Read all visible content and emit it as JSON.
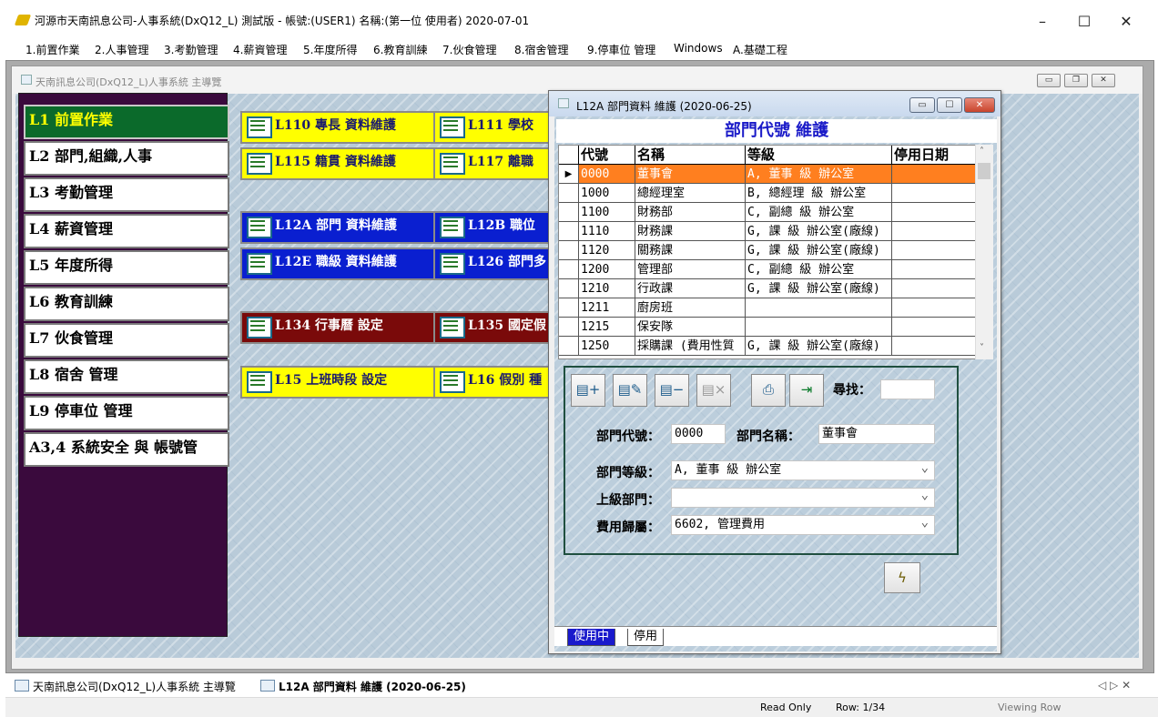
{
  "app": {
    "title": "河源市天南訊息公司-人事系統(DxQ12_L) 測試版 - 帳號:(USER1) 名稱:(第一位 使用者) 2020-07-01"
  },
  "window_controls": {
    "minimize": "–",
    "maximize": "☐",
    "close": "✕"
  },
  "menubar": [
    "1.前置作業",
    "2.人事管理",
    "3.考勤管理",
    "4.薪資管理",
    "5.年度所得",
    "6.教育訓練",
    "7.伙食管理",
    "8.宿舍管理",
    "9.停車位 管理",
    "Windows",
    "A.基礎工程"
  ],
  "main_window": {
    "title": "天南訊息公司(DxQ12_L)人事系統 主導覽"
  },
  "nav": [
    "L1 前置作業",
    "L2 部門,組織,人事",
    "L3 考勤管理",
    "L4 薪資管理",
    "L5 年度所得",
    "L6 教育訓練",
    "L7 伙食管理",
    "L8 宿舍 管理",
    "L9 停車位 管理",
    "A3,4 系統安全 與 帳號管"
  ],
  "shortcuts": [
    "L110 專長 資料維護",
    "L111 學校",
    "L115 籍貫 資料維護",
    "L117 離職",
    "L12A 部門 資料維護",
    "L12B 職位",
    "L12E 職級 資料維護",
    "L126 部門多",
    "L134 行事曆 設定",
    "L135 國定假",
    "L15 上班時段 設定",
    "L16 假別 種"
  ],
  "dialog": {
    "title": "L12A 部門資料 維護 (2020-06-25)",
    "heading": "部門代號 維護",
    "columns": [
      "代號",
      "名稱",
      "等級",
      "停用日期"
    ],
    "rows": [
      [
        "0000",
        "董事會",
        "A, 董事 級 辦公室",
        ""
      ],
      [
        "1000",
        "總經理室",
        "B, 總經理 級 辦公室",
        ""
      ],
      [
        "1100",
        "財務部",
        "C, 副總 級 辦公室",
        ""
      ],
      [
        "1110",
        "財務課",
        "G, 課 級 辦公室(廠線)",
        ""
      ],
      [
        "1120",
        "關務課",
        "G, 課 級 辦公室(廠線)",
        ""
      ],
      [
        "1200",
        "管理部",
        "C, 副總 級 辦公室",
        ""
      ],
      [
        "1210",
        "行政課",
        "G, 課 級 辦公室(廠線)",
        ""
      ],
      [
        "1211",
        "廚房班",
        "",
        ""
      ],
      [
        "1215",
        "保安隊",
        "",
        ""
      ],
      [
        "1250",
        "採購課 (費用性質",
        "G, 課 級 辦公室(廠線)",
        ""
      ]
    ],
    "row_indicator": "▶",
    "search_label": "尋找：",
    "search_value": "",
    "fields": {
      "dept_code_label": "部門代號：",
      "dept_code_value": "0000",
      "dept_name_label": "部門名稱：",
      "dept_name_value": "董事會",
      "dept_level_label": "部門等級：",
      "dept_level_value": "A, 董事 級 辦公室",
      "parent_label": "上級部門：",
      "parent_value": "",
      "expense_label": "費用歸屬：",
      "expense_value": "6602, 管理費用"
    },
    "tabs": [
      "使用中",
      "停用"
    ]
  },
  "taskbar": {
    "items": [
      "天南訊息公司(DxQ12_L)人事系統 主導覽",
      "L12A 部門資料 維護 (2020-06-25)"
    ],
    "nav_arrows": "◁ ▷ ✕"
  },
  "status": {
    "mode": "Read Only",
    "row": "Row: 1/34",
    "action": "Viewing Row"
  },
  "colors": {
    "nav_bg": "#3a0a3d",
    "nav_active_bg": "#0b6a2b",
    "nav_active_text": "#ffff00",
    "selected_row": "#ff7f1f",
    "heading_text": "#1a1ac8"
  }
}
